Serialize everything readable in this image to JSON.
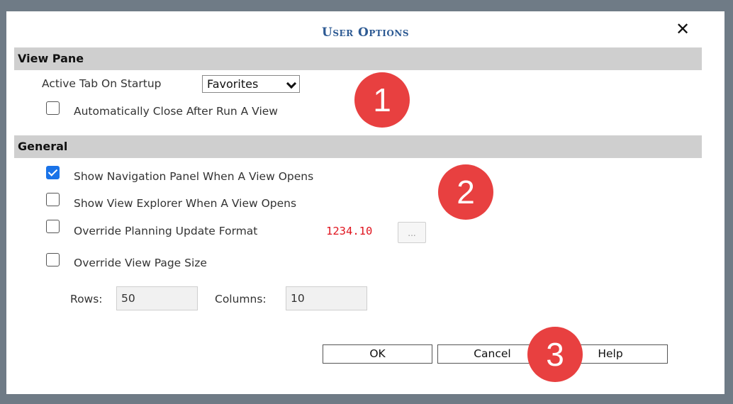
{
  "dialog": {
    "title": "User Options",
    "close_glyph": "✕"
  },
  "view_pane": {
    "header": "View Pane",
    "active_tab_label": "Active Tab On Startup",
    "active_tab_value": "Favorites",
    "auto_close_label": "Automatically Close After Run A View",
    "auto_close_checked": false
  },
  "general": {
    "header": "General",
    "show_nav_label": "Show Navigation Panel When A View Opens",
    "show_nav_checked": true,
    "show_explorer_label": "Show View Explorer When A View Opens",
    "show_explorer_checked": false,
    "override_planning_label": "Override Planning Update Format",
    "override_planning_value": "1234.10",
    "override_planning_checked": false,
    "override_planning_btn": "...",
    "override_page_label": "Override View Page Size",
    "override_page_checked": false,
    "rows_label": "Rows:",
    "rows_value": "50",
    "columns_label": "Columns:",
    "columns_value": "10"
  },
  "buttons": {
    "ok": "OK",
    "cancel": "Cancel",
    "help": "Help"
  },
  "badges": [
    "1",
    "2",
    "3"
  ],
  "colors": {
    "title": "#2d5a93",
    "badge": "#e84040",
    "red_value": "#e0141e",
    "checkbox_checked": "#1a73e8"
  }
}
